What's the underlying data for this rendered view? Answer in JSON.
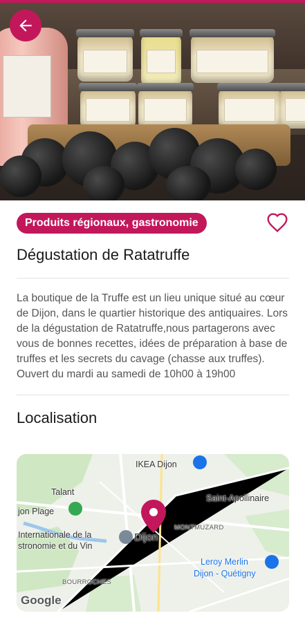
{
  "hero": {
    "alt_subject": "product-photo"
  },
  "category_badge": "Produits régionaux, gastronomie",
  "title": "Dégustation de Ratatruffe",
  "description": "La boutique de la Truffe est un lieu unique situé au cœur de Dijon, dans le quartier historique des antiquaires. Lors de la dégustation de Ratatruffe,nous partagerons avec vous de bonnes recettes, idées de préparation à base de truffes et les secrets du cavage (chasse aux truffes).",
  "hours": "Ouvert du mardi au samedi de 10h00 à 19h00",
  "location_title": "Localisation",
  "map": {
    "labels": {
      "ikea": "IKEA Dijon",
      "talant": "Talant",
      "plage": "jon Plage",
      "saint_apollinaire": "Saint-Apollinaire",
      "montmuzard": "MONTMUZARD",
      "internationale_1": "Internationale de la",
      "internationale_2": "stronomie et du Vin",
      "dijon": "Dijon",
      "leroy_1": "Leroy Merlin",
      "leroy_2": "Dijon - Quétigny",
      "bourroches": "BOURROCHES",
      "google": "Google"
    }
  },
  "colors": {
    "accent": "#c2185b"
  }
}
